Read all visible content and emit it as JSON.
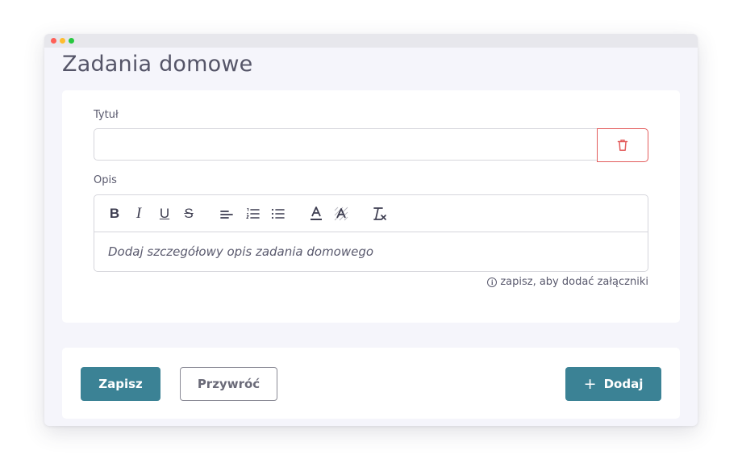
{
  "page": {
    "title": "Zadania domowe"
  },
  "form": {
    "title_label": "Tytuł",
    "title_value": "",
    "description_label": "Opis",
    "description_placeholder": "Dodaj szczegółowy opis zadania domowego",
    "attachments_hint": "zapisz, aby dodać załączniki"
  },
  "toolbar": {
    "bold": "B",
    "italic": "I",
    "underline": "U",
    "strike": "S",
    "color_letter": "A",
    "clear_letter": "T"
  },
  "actions": {
    "save_label": "Zapisz",
    "restore_label": "Przywróć",
    "add_label": "Dodaj"
  },
  "icons": {
    "delete": "trash-icon",
    "info": "info-icon",
    "plus": "plus-icon"
  },
  "colors": {
    "primary": "#3b8295",
    "danger": "#e35d5d",
    "background": "#f5f5fb"
  }
}
